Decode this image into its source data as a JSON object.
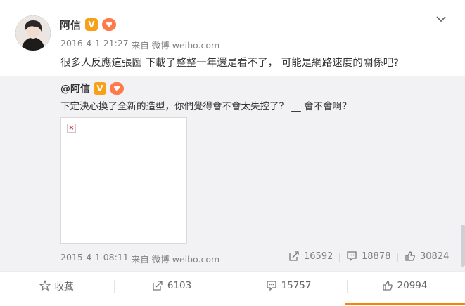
{
  "post": {
    "username": "阿信",
    "verified_mark": "V",
    "badge_icon": "fan-badge-icon",
    "timestamp": "2016-4-1 21:27",
    "source_prefix": "来自",
    "source": "微博 weibo.com",
    "text": "很多人反應這張圖  下載了整整一年還是看不了，   可能是網路速度的關係吧?"
  },
  "repost": {
    "username": "@阿信",
    "verified_mark": "V",
    "text": "下定決心換了全新的造型，你們覺得會不會太失控了？ __ 會不會啊？",
    "timestamp": "2015-4-1 08:11",
    "source_prefix": "来自",
    "source": "微博 weibo.com",
    "shares": "16592",
    "comments": "18878",
    "likes": "30824"
  },
  "actions": {
    "favorite": "收藏",
    "shares": "6103",
    "comments": "15757",
    "likes": "20994"
  },
  "colors": {
    "accent": "#ff8200",
    "verified": "#f7a11a",
    "repost_bg": "#f2f2f5",
    "meta_text": "#808080"
  }
}
